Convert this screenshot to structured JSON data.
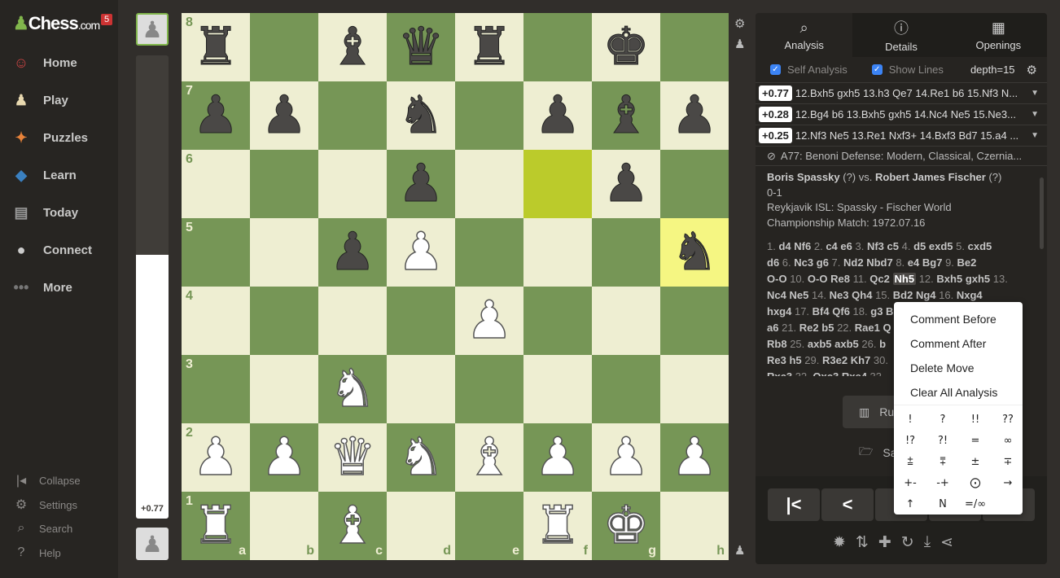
{
  "app": {
    "logo": "Chess",
    "logo_suffix": ".com",
    "notifications": "5"
  },
  "sidebar": {
    "items": [
      {
        "label": "Home",
        "icon": "avatar-icon"
      },
      {
        "label": "Play",
        "icon": "play-hand-icon"
      },
      {
        "label": "Puzzles",
        "icon": "puzzle-icon"
      },
      {
        "label": "Learn",
        "icon": "graduation-cap-icon"
      },
      {
        "label": "Today",
        "icon": "newspaper-icon"
      },
      {
        "label": "Connect",
        "icon": "chat-icon"
      },
      {
        "label": "More",
        "icon": "dots-icon"
      }
    ],
    "bottom": [
      {
        "label": "Collapse",
        "icon": "collapse-icon"
      },
      {
        "label": "Settings",
        "icon": "gear-icon"
      },
      {
        "label": "Search",
        "icon": "search-icon"
      },
      {
        "label": "Help",
        "icon": "help-icon"
      }
    ]
  },
  "eval": {
    "value": "+0.77",
    "white_fraction": 0.57
  },
  "board": {
    "ranks": [
      "8",
      "7",
      "6",
      "5",
      "4",
      "3",
      "2",
      "1"
    ],
    "files": [
      "a",
      "b",
      "c",
      "d",
      "e",
      "f",
      "g",
      "h"
    ],
    "position": [
      "r.bqr.k.",
      "pp.n.pbp",
      "...p..p.",
      "..pP...n",
      "....P...",
      "..N.....",
      "PPQNBPPP",
      "R.B..RK."
    ],
    "highlights": [
      "f6",
      "h5"
    ],
    "colors": {
      "light": "#eeeed2",
      "dark": "#769656",
      "highlight_from": "#bbcb2b",
      "highlight_to": "#f5f682"
    }
  },
  "panel": {
    "tabs": [
      {
        "label": "Analysis",
        "icon": "analysis-icon",
        "active": true
      },
      {
        "label": "Details",
        "icon": "info-icon"
      },
      {
        "label": "Openings",
        "icon": "book-icon"
      }
    ],
    "self_analysis": "Self Analysis",
    "show_lines": "Show Lines",
    "depth": "depth=15",
    "lines": [
      {
        "score": "+0.77",
        "moves": "12.Bxh5 gxh5 13.h3 Qe7 14.Re1 b6 15.Nf3 N..."
      },
      {
        "score": "+0.28",
        "moves": "12.Bg4 b6 13.Bxh5 gxh5 14.Nc4 Ne5 15.Ne3..."
      },
      {
        "score": "+0.25",
        "moves": "12.Nf3 Ne5 13.Re1 Nxf3+ 14.Bxf3 Bd7 15.a4 ..."
      }
    ],
    "opening": "A77: Benoni Defense: Modern, Classical, Czernia...",
    "game": {
      "white": "Boris Spassky",
      "white_rating": "(?)",
      "vs": "vs.",
      "black": "Robert James Fischer",
      "black_rating": "(?)",
      "result": "0-1",
      "event": "Reykjavik ISL: Spassky - Fischer World Championship Match: 1972.07.16"
    },
    "moves": [
      "1. d4 Nf6 2. c4 e6 3. Nf3 c5 4. d5 exd5 5. cxd5",
      "d6 6. Nc3 g6 7. Nd2 Nbd7 8. e4 Bg7 9. Be2",
      "O-O 10. O-O Re8 11. Qc2 Nh5 12. Bxh5 gxh5 13.",
      "Nc4 Ne5 14. Ne3 Qh4 15. Bd2 Ng4 16. Nxg4",
      "hxg4 17. Bf4 Qf6 18. g3 B",
      "a6 21. Re2 b5 22. Rae1 Q",
      "Rb8 25. axb5 axb5 26. b",
      "Re3 h5 29. R3e2 Kh7 30.",
      "Rxc3 32. Qxc3 Rxe4 33."
    ],
    "current_move": "Nh5",
    "run_label": "Ru",
    "save_label": "Sav"
  },
  "context_menu": {
    "items": [
      "Comment Before",
      "Comment After",
      "Delete Move",
      "Clear All Analysis"
    ],
    "symbols": [
      "!",
      "?",
      "!!",
      "??",
      "!?",
      "?!",
      "=",
      "∞",
      "⩲",
      "⩱",
      "±",
      "∓",
      "+-",
      "-+",
      "⨀",
      "→",
      "↑",
      "N",
      "=/∞"
    ]
  }
}
